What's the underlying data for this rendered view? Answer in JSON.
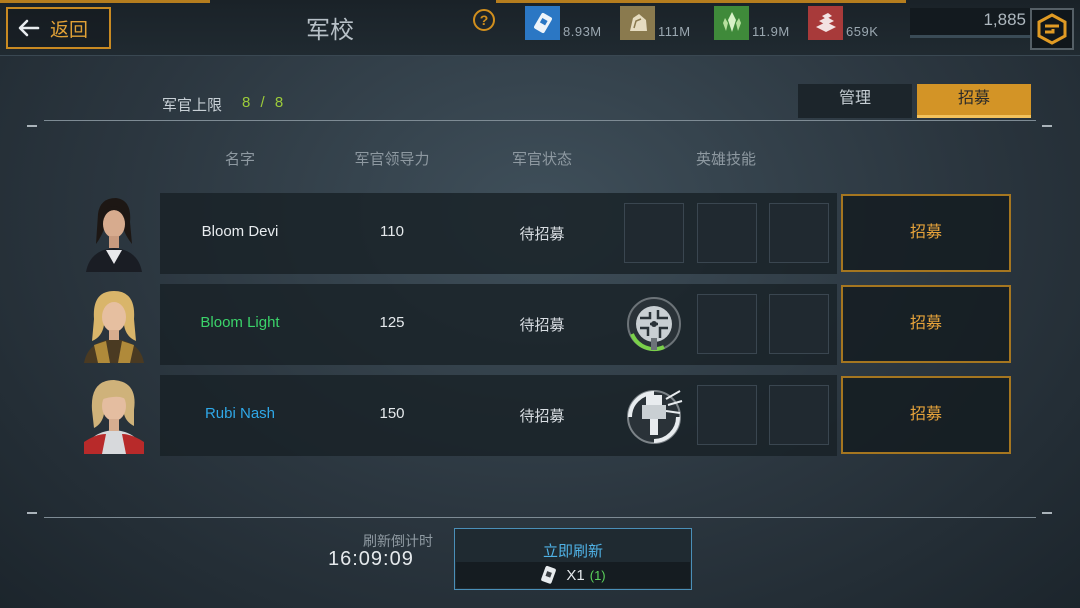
{
  "header": {
    "back_label": "返回",
    "title": "军校",
    "help_icon": "question-icon",
    "gold": "1,885"
  },
  "resources": [
    {
      "name": "supply-card-icon",
      "value": "8.93M",
      "color": "#2b77c4"
    },
    {
      "name": "ore-rock-icon",
      "value": "111M",
      "color": "#8a7a4e"
    },
    {
      "name": "crystal-icon",
      "value": "11.9M",
      "color": "#3f8a3a"
    },
    {
      "name": "metal-bars-icon",
      "value": "659K",
      "color": "#a83a3a"
    }
  ],
  "capacity": {
    "label": "军官上限",
    "value": "8 / 8"
  },
  "tabs": {
    "manage": "管理",
    "recruit": "招募"
  },
  "columns": {
    "name": "名字",
    "leadership": "军官领导力",
    "status": "军官状态",
    "skills": "英雄技能"
  },
  "officers": [
    {
      "name": "Bloom Devi",
      "name_color": "#e8ecef",
      "leadership": "110",
      "status": "待招募",
      "recruit_label": "招募"
    },
    {
      "name": "Bloom Light",
      "name_color": "#3bd36a",
      "leadership": "125",
      "status": "待招募",
      "recruit_label": "招募"
    },
    {
      "name": "Rubi Nash",
      "name_color": "#2fa8e8",
      "leadership": "150",
      "status": "待招募",
      "recruit_label": "招募"
    }
  ],
  "refresh": {
    "label": "刷新倒计时",
    "timer": "16:09:09",
    "button_label": "立即刷新",
    "cost": "X1",
    "owned": "(1)"
  },
  "colors": {
    "accent": "#d39426",
    "refresh_blue": "#4fb2e6"
  }
}
